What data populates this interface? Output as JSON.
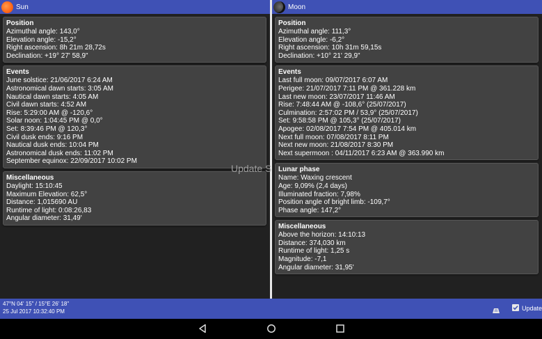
{
  "sun": {
    "title": "Sun",
    "position": {
      "title": "Position",
      "rows": [
        "Azimuthal angle: 143,0°",
        "Elevation angle: -15,2°",
        "Right ascension: 8h 21m 28,72s",
        "Declination: +19° 27' 58,9\""
      ]
    },
    "events": {
      "title": "Events",
      "rows": [
        "June solstice: 21/06/2017 6:24 AM",
        "Astronomical dawn starts: 3:05 AM",
        "Nautical dawn starts: 4:05 AM",
        "Civil dawn starts: 4:52 AM",
        "Rise: 5:29:00 AM @ -120,6°",
        "Solar noon: 1:04:45 PM @ 0,0°",
        "Set: 8:39:46 PM @ 120,3°",
        "Civil dusk ends: 9:16 PM",
        "Nautical dusk ends: 10:04 PM",
        "Astronomical dusk ends: 11:02 PM",
        "September equinox: 22/09/2017 10:02 PM"
      ]
    },
    "misc": {
      "title": "Miscellaneous",
      "rows": [
        "Daylight: 15:10:45",
        "Maximum Elevation: 62,5°",
        "Distance: 1,015690 AU",
        "Runtime of light: 0:08:26,83",
        "Angular diameter: 31,49'"
      ]
    }
  },
  "moon": {
    "title": "Moon",
    "position": {
      "title": "Position",
      "rows": [
        "Azimuthal angle: 111,3°",
        "Elevation angle: -6,2°",
        "Right ascension: 10h 31m 59,15s",
        "Declination: +10° 21' 29,9\""
      ]
    },
    "events": {
      "title": "Events",
      "rows": [
        "Last full moon: 09/07/2017 6:07 AM",
        "Perigee: 21/07/2017 7:11 PM @ 361.228 km",
        "Last new moon: 23/07/2017 11:46 AM",
        "Rise: 7:48:44 AM @ -108,6° (25/07/2017)",
        "Culmination: 2:57:02 PM / 53,9° (25/07/2017)",
        "Set: 9:58:58 PM @ 105,3° (25/07/2017)",
        "Apogee: 02/08/2017 7:54 PM @ 405.014 km",
        "Next full moon: 07/08/2017 8:11 PM",
        "Next new moon: 21/08/2017 8:30 PM",
        "Next supermoon : 04/11/2017 6:23 AM @ 363.990 km"
      ]
    },
    "phase": {
      "title": "Lunar phase",
      "rows": [
        "Name: Waxing crescent",
        "Age: 9,09% (2,4 days)",
        "Illuminated fraction: 7,98%",
        "Position angle of bright limb: -109,7°",
        "Phase angle: 147,2°"
      ]
    },
    "misc": {
      "title": "Miscellaneous",
      "rows": [
        "Above the horizon: 14:10:13",
        "Distance: 374,030 km",
        "Runtime of light: 1,25 s",
        "Magnitude: -7,1",
        "Angular diameter: 31,95'"
      ]
    }
  },
  "overlay": {
    "text": "Update S"
  },
  "status": {
    "coordinates": "47°N 04' 15\" / 15°E 26' 18\"",
    "datetime": "25 Jul 2017 10:32:40 PM",
    "update_label": "Update",
    "update_checked": true
  },
  "icons": {
    "sun": "sun-icon",
    "moon": "moon-icon",
    "location": "location-icon",
    "back": "back-icon",
    "home": "home-icon",
    "recents": "recents-icon"
  },
  "colors": {
    "header": "#3f51b5",
    "card": "#424242",
    "background": "#212121"
  }
}
